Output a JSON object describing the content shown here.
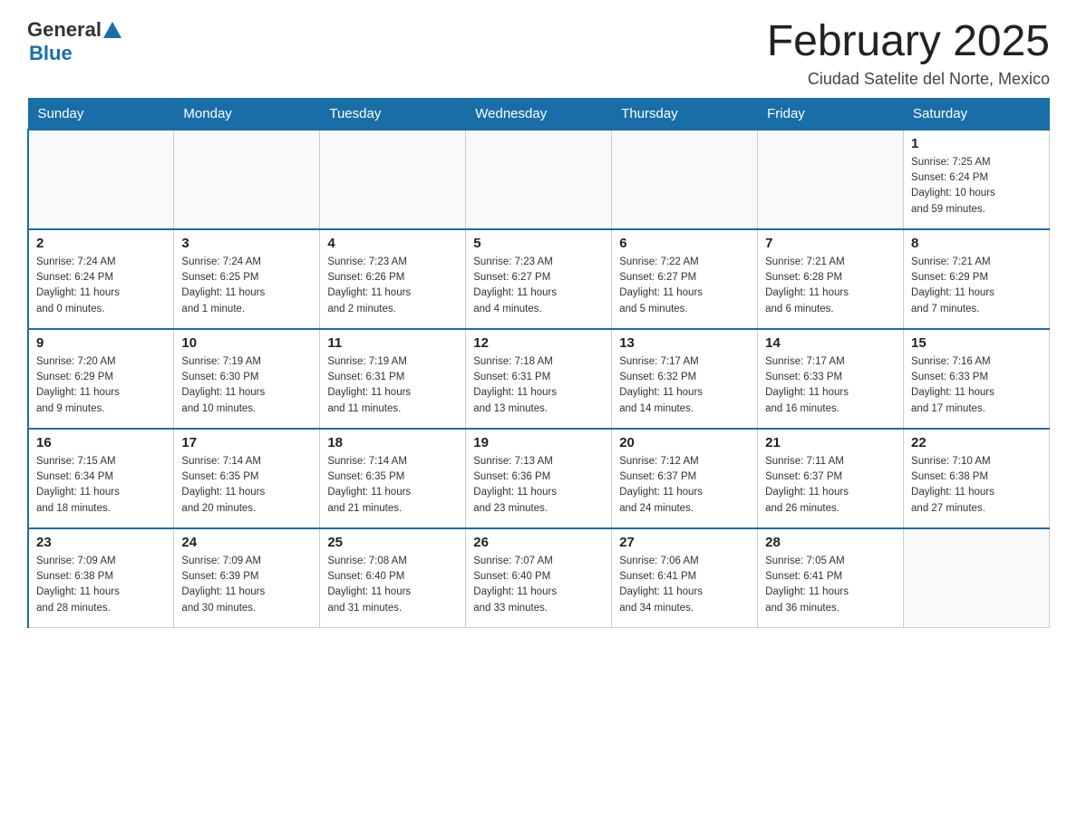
{
  "header": {
    "logo_general": "General",
    "logo_blue": "Blue",
    "month_title": "February 2025",
    "location": "Ciudad Satelite del Norte, Mexico"
  },
  "weekdays": [
    "Sunday",
    "Monday",
    "Tuesday",
    "Wednesday",
    "Thursday",
    "Friday",
    "Saturday"
  ],
  "weeks": [
    [
      {
        "day": "",
        "info": ""
      },
      {
        "day": "",
        "info": ""
      },
      {
        "day": "",
        "info": ""
      },
      {
        "day": "",
        "info": ""
      },
      {
        "day": "",
        "info": ""
      },
      {
        "day": "",
        "info": ""
      },
      {
        "day": "1",
        "info": "Sunrise: 7:25 AM\nSunset: 6:24 PM\nDaylight: 10 hours\nand 59 minutes."
      }
    ],
    [
      {
        "day": "2",
        "info": "Sunrise: 7:24 AM\nSunset: 6:24 PM\nDaylight: 11 hours\nand 0 minutes."
      },
      {
        "day": "3",
        "info": "Sunrise: 7:24 AM\nSunset: 6:25 PM\nDaylight: 11 hours\nand 1 minute."
      },
      {
        "day": "4",
        "info": "Sunrise: 7:23 AM\nSunset: 6:26 PM\nDaylight: 11 hours\nand 2 minutes."
      },
      {
        "day": "5",
        "info": "Sunrise: 7:23 AM\nSunset: 6:27 PM\nDaylight: 11 hours\nand 4 minutes."
      },
      {
        "day": "6",
        "info": "Sunrise: 7:22 AM\nSunset: 6:27 PM\nDaylight: 11 hours\nand 5 minutes."
      },
      {
        "day": "7",
        "info": "Sunrise: 7:21 AM\nSunset: 6:28 PM\nDaylight: 11 hours\nand 6 minutes."
      },
      {
        "day": "8",
        "info": "Sunrise: 7:21 AM\nSunset: 6:29 PM\nDaylight: 11 hours\nand 7 minutes."
      }
    ],
    [
      {
        "day": "9",
        "info": "Sunrise: 7:20 AM\nSunset: 6:29 PM\nDaylight: 11 hours\nand 9 minutes."
      },
      {
        "day": "10",
        "info": "Sunrise: 7:19 AM\nSunset: 6:30 PM\nDaylight: 11 hours\nand 10 minutes."
      },
      {
        "day": "11",
        "info": "Sunrise: 7:19 AM\nSunset: 6:31 PM\nDaylight: 11 hours\nand 11 minutes."
      },
      {
        "day": "12",
        "info": "Sunrise: 7:18 AM\nSunset: 6:31 PM\nDaylight: 11 hours\nand 13 minutes."
      },
      {
        "day": "13",
        "info": "Sunrise: 7:17 AM\nSunset: 6:32 PM\nDaylight: 11 hours\nand 14 minutes."
      },
      {
        "day": "14",
        "info": "Sunrise: 7:17 AM\nSunset: 6:33 PM\nDaylight: 11 hours\nand 16 minutes."
      },
      {
        "day": "15",
        "info": "Sunrise: 7:16 AM\nSunset: 6:33 PM\nDaylight: 11 hours\nand 17 minutes."
      }
    ],
    [
      {
        "day": "16",
        "info": "Sunrise: 7:15 AM\nSunset: 6:34 PM\nDaylight: 11 hours\nand 18 minutes."
      },
      {
        "day": "17",
        "info": "Sunrise: 7:14 AM\nSunset: 6:35 PM\nDaylight: 11 hours\nand 20 minutes."
      },
      {
        "day": "18",
        "info": "Sunrise: 7:14 AM\nSunset: 6:35 PM\nDaylight: 11 hours\nand 21 minutes."
      },
      {
        "day": "19",
        "info": "Sunrise: 7:13 AM\nSunset: 6:36 PM\nDaylight: 11 hours\nand 23 minutes."
      },
      {
        "day": "20",
        "info": "Sunrise: 7:12 AM\nSunset: 6:37 PM\nDaylight: 11 hours\nand 24 minutes."
      },
      {
        "day": "21",
        "info": "Sunrise: 7:11 AM\nSunset: 6:37 PM\nDaylight: 11 hours\nand 26 minutes."
      },
      {
        "day": "22",
        "info": "Sunrise: 7:10 AM\nSunset: 6:38 PM\nDaylight: 11 hours\nand 27 minutes."
      }
    ],
    [
      {
        "day": "23",
        "info": "Sunrise: 7:09 AM\nSunset: 6:38 PM\nDaylight: 11 hours\nand 28 minutes."
      },
      {
        "day": "24",
        "info": "Sunrise: 7:09 AM\nSunset: 6:39 PM\nDaylight: 11 hours\nand 30 minutes."
      },
      {
        "day": "25",
        "info": "Sunrise: 7:08 AM\nSunset: 6:40 PM\nDaylight: 11 hours\nand 31 minutes."
      },
      {
        "day": "26",
        "info": "Sunrise: 7:07 AM\nSunset: 6:40 PM\nDaylight: 11 hours\nand 33 minutes."
      },
      {
        "day": "27",
        "info": "Sunrise: 7:06 AM\nSunset: 6:41 PM\nDaylight: 11 hours\nand 34 minutes."
      },
      {
        "day": "28",
        "info": "Sunrise: 7:05 AM\nSunset: 6:41 PM\nDaylight: 11 hours\nand 36 minutes."
      },
      {
        "day": "",
        "info": ""
      }
    ]
  ]
}
